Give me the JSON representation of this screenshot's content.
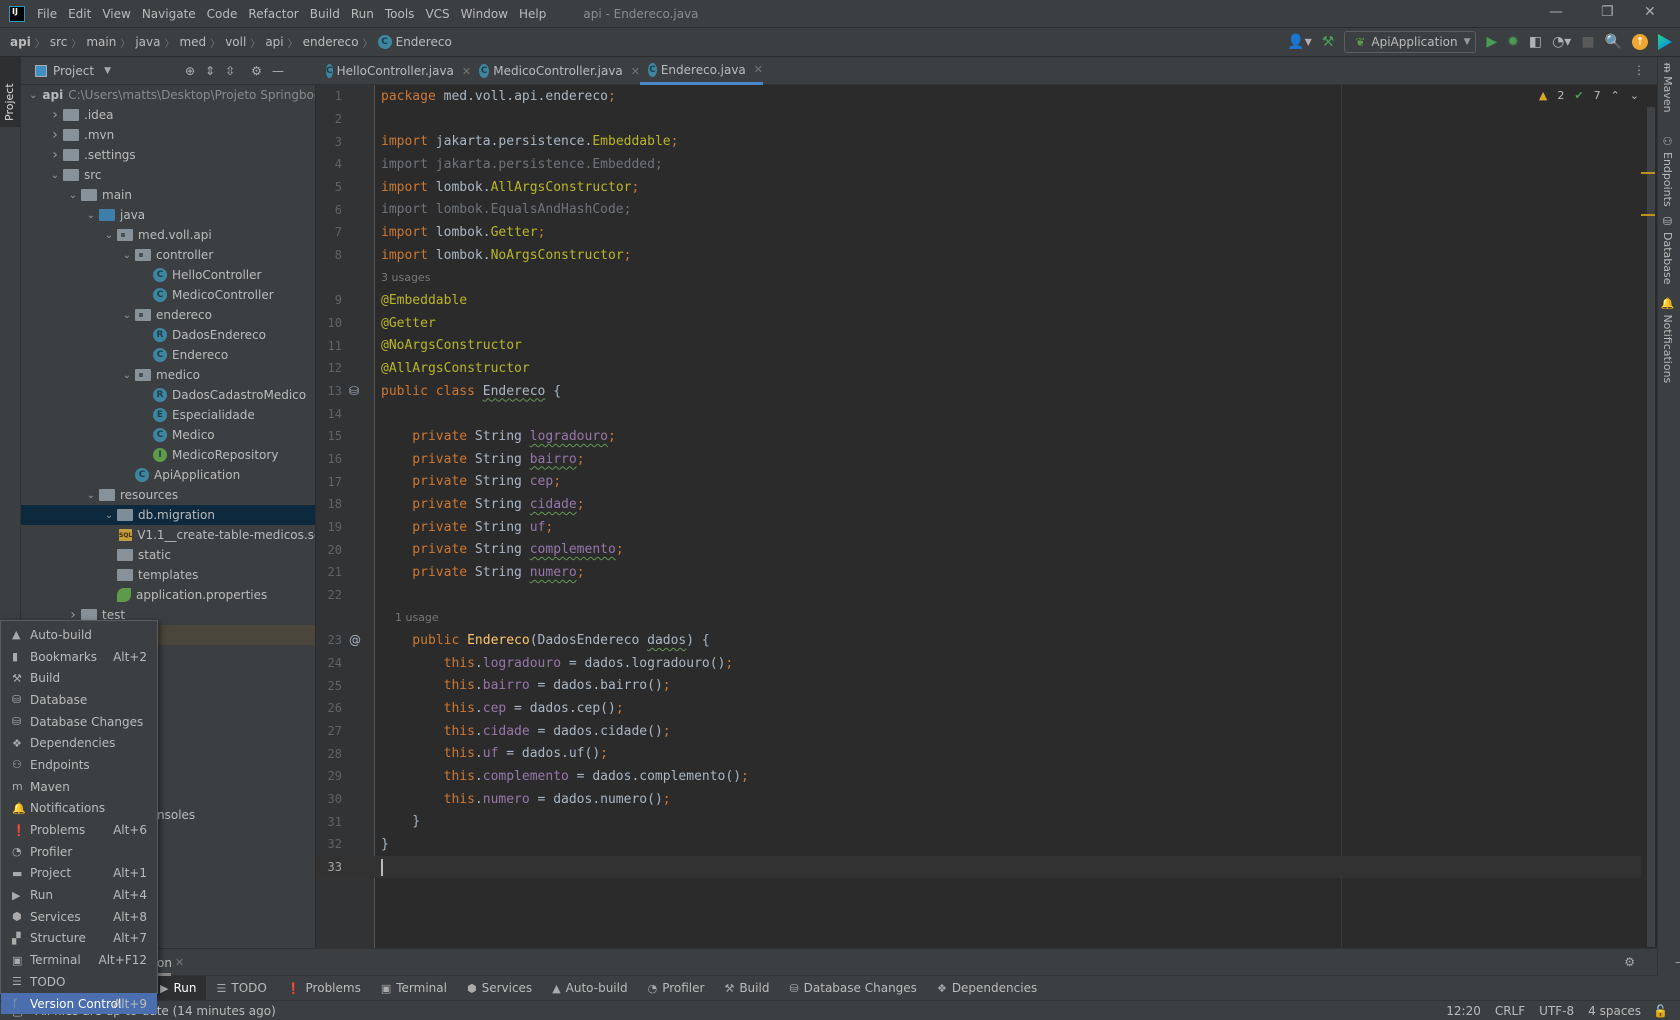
{
  "titlebar": {
    "menu": [
      "File",
      "Edit",
      "View",
      "Navigate",
      "Code",
      "Refactor",
      "Build",
      "Run",
      "Tools",
      "VCS",
      "Window",
      "Help"
    ],
    "title": "api - Endereco.java"
  },
  "breadcrumb": [
    "api",
    "src",
    "main",
    "java",
    "med",
    "voll",
    "api",
    "endereco",
    "Endereco"
  ],
  "toolbar": {
    "run_config": "ApiApplication"
  },
  "project": {
    "header": "Project",
    "tree": [
      {
        "level": 0,
        "arrow": "down",
        "icon": "module",
        "label": "api",
        "path": "C:\\Users\\matts\\Desktop\\Projeto Springboot"
      },
      {
        "level": 1,
        "arrow": "right",
        "icon": "folder",
        "label": ".idea"
      },
      {
        "level": 1,
        "arrow": "right",
        "icon": "folder",
        "label": ".mvn"
      },
      {
        "level": 1,
        "arrow": "right",
        "icon": "folder",
        "label": ".settings"
      },
      {
        "level": 1,
        "arrow": "down",
        "icon": "folder",
        "label": "src"
      },
      {
        "level": 2,
        "arrow": "down",
        "icon": "folder",
        "label": "main"
      },
      {
        "level": 3,
        "arrow": "down",
        "icon": "source-folder",
        "label": "java"
      },
      {
        "level": 4,
        "arrow": "down",
        "icon": "package",
        "label": "med.voll.api"
      },
      {
        "level": 5,
        "arrow": "down",
        "icon": "package",
        "label": "controller"
      },
      {
        "level": 6,
        "arrow": "",
        "icon": "class",
        "letter": "C",
        "label": "HelloController"
      },
      {
        "level": 6,
        "arrow": "",
        "icon": "class",
        "letter": "C",
        "label": "MedicoController"
      },
      {
        "level": 5,
        "arrow": "down",
        "icon": "package",
        "label": "endereco"
      },
      {
        "level": 6,
        "arrow": "",
        "icon": "record",
        "letter": "R",
        "label": "DadosEndereco"
      },
      {
        "level": 6,
        "arrow": "",
        "icon": "class",
        "letter": "C",
        "label": "Endereco"
      },
      {
        "level": 5,
        "arrow": "down",
        "icon": "package",
        "label": "medico"
      },
      {
        "level": 6,
        "arrow": "",
        "icon": "record",
        "letter": "R",
        "label": "DadosCadastroMedico"
      },
      {
        "level": 6,
        "arrow": "",
        "icon": "enum",
        "letter": "E",
        "label": "Especialidade"
      },
      {
        "level": 6,
        "arrow": "",
        "icon": "class",
        "letter": "C",
        "label": "Medico"
      },
      {
        "level": 6,
        "arrow": "",
        "icon": "interface",
        "letter": "I",
        "label": "MedicoRepository"
      },
      {
        "level": 5,
        "arrow": "",
        "icon": "spring-app",
        "letter": "C",
        "label": "ApiApplication"
      },
      {
        "level": 3,
        "arrow": "down",
        "icon": "resources-folder",
        "label": "resources"
      },
      {
        "level": 4,
        "arrow": "down",
        "icon": "folder",
        "label": "db.migration"
      },
      {
        "level": 5,
        "arrow": "",
        "icon": "sql",
        "label": "V1.1__create-table-medicos.sql"
      },
      {
        "level": 4,
        "arrow": "",
        "icon": "folder",
        "label": "static"
      },
      {
        "level": 4,
        "arrow": "",
        "icon": "folder",
        "label": "templates"
      },
      {
        "level": 4,
        "arrow": "",
        "icon": "properties",
        "label": "application.properties"
      },
      {
        "level": 2,
        "arrow": "right",
        "icon": "folder",
        "label": "test"
      }
    ],
    "partial_item": "nsoles"
  },
  "tabs": [
    {
      "label": "HelloController.java"
    },
    {
      "label": "MedicoController.java"
    },
    {
      "label": "Endereco.java",
      "active": true
    }
  ],
  "inspections": {
    "warnings": "2",
    "weak_warnings": "7"
  },
  "code": [
    {
      "n": "1",
      "t": [
        [
          "k",
          "package "
        ],
        [
          "t",
          "med.voll.api.endereco"
        ],
        [
          "k",
          ";"
        ]
      ]
    },
    {
      "n": "2",
      "t": []
    },
    {
      "n": "3",
      "t": [
        [
          "k",
          "import "
        ],
        [
          "t",
          "jakarta.persistence."
        ],
        [
          "a",
          "Embeddable"
        ],
        [
          "k",
          ";"
        ]
      ]
    },
    {
      "n": "4",
      "t": [
        [
          "g",
          "import jakarta.persistence.Embedded;"
        ]
      ]
    },
    {
      "n": "5",
      "t": [
        [
          "k",
          "import "
        ],
        [
          "t",
          "lombok."
        ],
        [
          "a",
          "AllArgsConstructor"
        ],
        [
          "k",
          ";"
        ]
      ]
    },
    {
      "n": "6",
      "t": [
        [
          "g",
          "import lombok.EqualsAndHashCode;"
        ]
      ]
    },
    {
      "n": "7",
      "t": [
        [
          "k",
          "import "
        ],
        [
          "t",
          "lombok."
        ],
        [
          "a",
          "Getter"
        ],
        [
          "k",
          ";"
        ]
      ]
    },
    {
      "n": "8",
      "t": [
        [
          "k",
          "import "
        ],
        [
          "t",
          "lombok."
        ],
        [
          "a",
          "NoArgsConstructor"
        ],
        [
          "k",
          ";"
        ]
      ]
    },
    {
      "n": "",
      "hint": "3 usages"
    },
    {
      "n": "9",
      "t": [
        [
          "a",
          "@Embeddable"
        ]
      ]
    },
    {
      "n": "10",
      "t": [
        [
          "a",
          "@Getter"
        ]
      ]
    },
    {
      "n": "11",
      "t": [
        [
          "a",
          "@NoArgsConstructor"
        ]
      ]
    },
    {
      "n": "12",
      "t": [
        [
          "a",
          "@AllArgsConstructor"
        ]
      ]
    },
    {
      "n": "13",
      "t": [
        [
          "k",
          "public class "
        ],
        [
          "t w",
          "Endereco"
        ],
        [
          "t",
          " {"
        ]
      ]
    },
    {
      "n": "14",
      "t": []
    },
    {
      "n": "15",
      "t": [
        [
          "k",
          "    private "
        ],
        [
          "t",
          "String "
        ],
        [
          "f w",
          "logradouro"
        ],
        [
          "k",
          ";"
        ]
      ]
    },
    {
      "n": "16",
      "t": [
        [
          "k",
          "    private "
        ],
        [
          "t",
          "String "
        ],
        [
          "f w",
          "bairro"
        ],
        [
          "k",
          ";"
        ]
      ]
    },
    {
      "n": "17",
      "t": [
        [
          "k",
          "    private "
        ],
        [
          "t",
          "String "
        ],
        [
          "f",
          "cep"
        ],
        [
          "k",
          ";"
        ]
      ]
    },
    {
      "n": "18",
      "t": [
        [
          "k",
          "    private "
        ],
        [
          "t",
          "String "
        ],
        [
          "f w",
          "cidade"
        ],
        [
          "k",
          ";"
        ]
      ]
    },
    {
      "n": "19",
      "t": [
        [
          "k",
          "    private "
        ],
        [
          "t",
          "String "
        ],
        [
          "f",
          "uf"
        ],
        [
          "k",
          ";"
        ]
      ]
    },
    {
      "n": "20",
      "t": [
        [
          "k",
          "    private "
        ],
        [
          "t",
          "String "
        ],
        [
          "f w",
          "complemento"
        ],
        [
          "k",
          ";"
        ]
      ]
    },
    {
      "n": "21",
      "t": [
        [
          "k",
          "    private "
        ],
        [
          "t",
          "String "
        ],
        [
          "f w",
          "numero"
        ],
        [
          "k",
          ";"
        ]
      ]
    },
    {
      "n": "22",
      "t": []
    },
    {
      "n": "",
      "hint": "    1 usage"
    },
    {
      "n": "23",
      "t": [
        [
          "k",
          "    public "
        ],
        [
          "m",
          "Endereco"
        ],
        [
          "t",
          "(DadosEndereco "
        ],
        [
          "t w",
          "dados"
        ],
        [
          "t",
          ") {"
        ]
      ]
    },
    {
      "n": "24",
      "t": [
        [
          "k",
          "        this"
        ],
        [
          "t",
          "."
        ],
        [
          "f",
          "logradouro"
        ],
        [
          "t",
          " = dados.logradouro()"
        ],
        [
          "k",
          ";"
        ]
      ]
    },
    {
      "n": "25",
      "t": [
        [
          "k",
          "        this"
        ],
        [
          "t",
          "."
        ],
        [
          "f",
          "bairro"
        ],
        [
          "t",
          " = dados.bairro()"
        ],
        [
          "k",
          ";"
        ]
      ]
    },
    {
      "n": "26",
      "t": [
        [
          "k",
          "        this"
        ],
        [
          "t",
          "."
        ],
        [
          "f",
          "cep"
        ],
        [
          "t",
          " = dados.cep()"
        ],
        [
          "k",
          ";"
        ]
      ]
    },
    {
      "n": "27",
      "t": [
        [
          "k",
          "        this"
        ],
        [
          "t",
          "."
        ],
        [
          "f",
          "cidade"
        ],
        [
          "t",
          " = dados.cidade()"
        ],
        [
          "k",
          ";"
        ]
      ]
    },
    {
      "n": "28",
      "t": [
        [
          "k",
          "        this"
        ],
        [
          "t",
          "."
        ],
        [
          "f",
          "uf"
        ],
        [
          "t",
          " = dados.uf()"
        ],
        [
          "k",
          ";"
        ]
      ]
    },
    {
      "n": "29",
      "t": [
        [
          "k",
          "        this"
        ],
        [
          "t",
          "."
        ],
        [
          "f",
          "complemento"
        ],
        [
          "t",
          " = dados.complemento()"
        ],
        [
          "k",
          ";"
        ]
      ]
    },
    {
      "n": "30",
      "t": [
        [
          "k",
          "        this"
        ],
        [
          "t",
          "."
        ],
        [
          "f",
          "numero"
        ],
        [
          "t",
          " = dados.numero()"
        ],
        [
          "k",
          ";"
        ]
      ]
    },
    {
      "n": "31",
      "t": [
        [
          "t",
          "    }"
        ]
      ]
    },
    {
      "n": "32",
      "t": [
        [
          "t",
          "}"
        ]
      ]
    },
    {
      "n": "33",
      "t": [],
      "current": true
    }
  ],
  "right_stripe": [
    "Maven",
    "Endpoints",
    "Database",
    "Notifications"
  ],
  "bottom_header": {
    "partial_tab": "on"
  },
  "bottom_tabs": [
    {
      "icon": "run-icon",
      "label": "Run",
      "active": true
    },
    {
      "icon": "todo-icon",
      "label": "TODO"
    },
    {
      "icon": "problems-icon",
      "label": "Problems"
    },
    {
      "icon": "terminal-icon",
      "label": "Terminal"
    },
    {
      "icon": "services-icon",
      "label": "Services"
    },
    {
      "icon": "auto-build-icon",
      "label": "Auto-build"
    },
    {
      "icon": "profiler-icon",
      "label": "Profiler"
    },
    {
      "icon": "build-icon",
      "label": "Build"
    },
    {
      "icon": "database-changes-icon",
      "label": "Database Changes"
    },
    {
      "icon": "dependencies-icon",
      "label": "Dependencies"
    }
  ],
  "popup": [
    {
      "icon": "warning-icon",
      "label": "Auto-build",
      "shortcut": ""
    },
    {
      "icon": "bookmark-icon",
      "label": "Bookmarks",
      "shortcut": "Alt+2"
    },
    {
      "icon": "hammer-icon",
      "label": "Build",
      "shortcut": ""
    },
    {
      "icon": "database-icon",
      "label": "Database",
      "shortcut": ""
    },
    {
      "icon": "database-changes-icon",
      "label": "Database Changes",
      "shortcut": ""
    },
    {
      "icon": "layers-icon",
      "label": "Dependencies",
      "shortcut": ""
    },
    {
      "icon": "endpoints-icon",
      "label": "Endpoints",
      "shortcut": ""
    },
    {
      "icon": "maven-icon",
      "label": "Maven",
      "shortcut": ""
    },
    {
      "icon": "bell-icon",
      "label": "Notifications",
      "shortcut": ""
    },
    {
      "icon": "problems-icon",
      "label": "Problems",
      "shortcut": "Alt+6"
    },
    {
      "icon": "profiler-icon",
      "label": "Profiler",
      "shortcut": ""
    },
    {
      "icon": "folder-icon",
      "label": "Project",
      "shortcut": "Alt+1"
    },
    {
      "icon": "run-icon",
      "label": "Run",
      "shortcut": "Alt+4"
    },
    {
      "icon": "services-icon",
      "label": "Services",
      "shortcut": "Alt+8"
    },
    {
      "icon": "structure-icon",
      "label": "Structure",
      "shortcut": "Alt+7"
    },
    {
      "icon": "terminal-icon",
      "label": "Terminal",
      "shortcut": "Alt+F12"
    },
    {
      "icon": "todo-icon",
      "label": "TODO",
      "shortcut": ""
    },
    {
      "icon": "vcs-icon",
      "label": "Version Control",
      "shortcut": "Alt+9",
      "selected": true
    }
  ],
  "status": {
    "message": "All files are up-to-date (14 minutes ago)",
    "position": "12:20",
    "line_sep": "CRLF",
    "encoding": "UTF-8",
    "indent": "4 spaces"
  },
  "colors": {
    "editor_bg": "#2b2b2b",
    "panel_bg": "#3c3f41",
    "keyword": "#cc7832",
    "annotation": "#bbb529",
    "field": "#9876aa",
    "selection": "#4b6eaf"
  }
}
